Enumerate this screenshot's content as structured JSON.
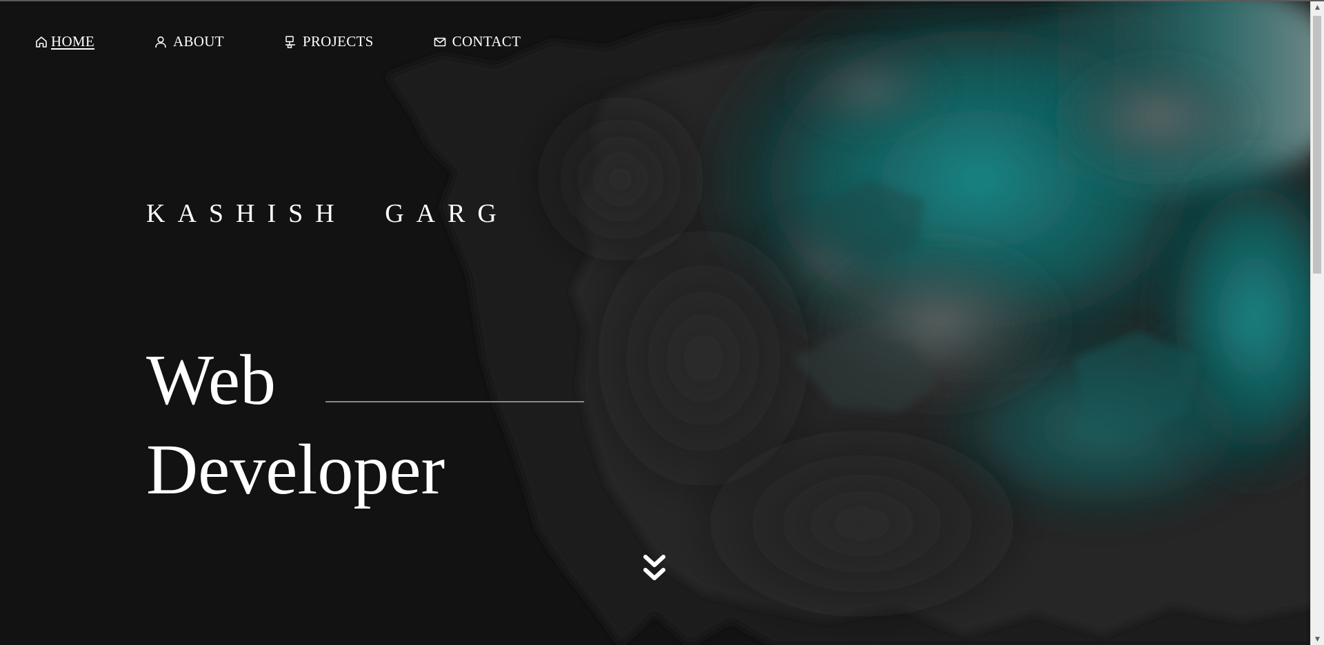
{
  "nav": {
    "items": [
      {
        "label": "HOME",
        "icon": "home-icon",
        "active": true
      },
      {
        "label": "ABOUT",
        "icon": "user-icon",
        "active": false
      },
      {
        "label": "PROJECTS",
        "icon": "network-icon",
        "active": false
      },
      {
        "label": "CONTACT",
        "icon": "mail-icon",
        "active": false
      }
    ]
  },
  "hero": {
    "name": "KASHISH GARG",
    "title_line1": "Web",
    "title_line2": "Developer",
    "scroll_icon": "double-chevron-down-icon"
  },
  "colors": {
    "background": "#121212",
    "text": "#ffffff",
    "accent_teal": "#0f6b6b",
    "rule": "#8a8a8a"
  }
}
